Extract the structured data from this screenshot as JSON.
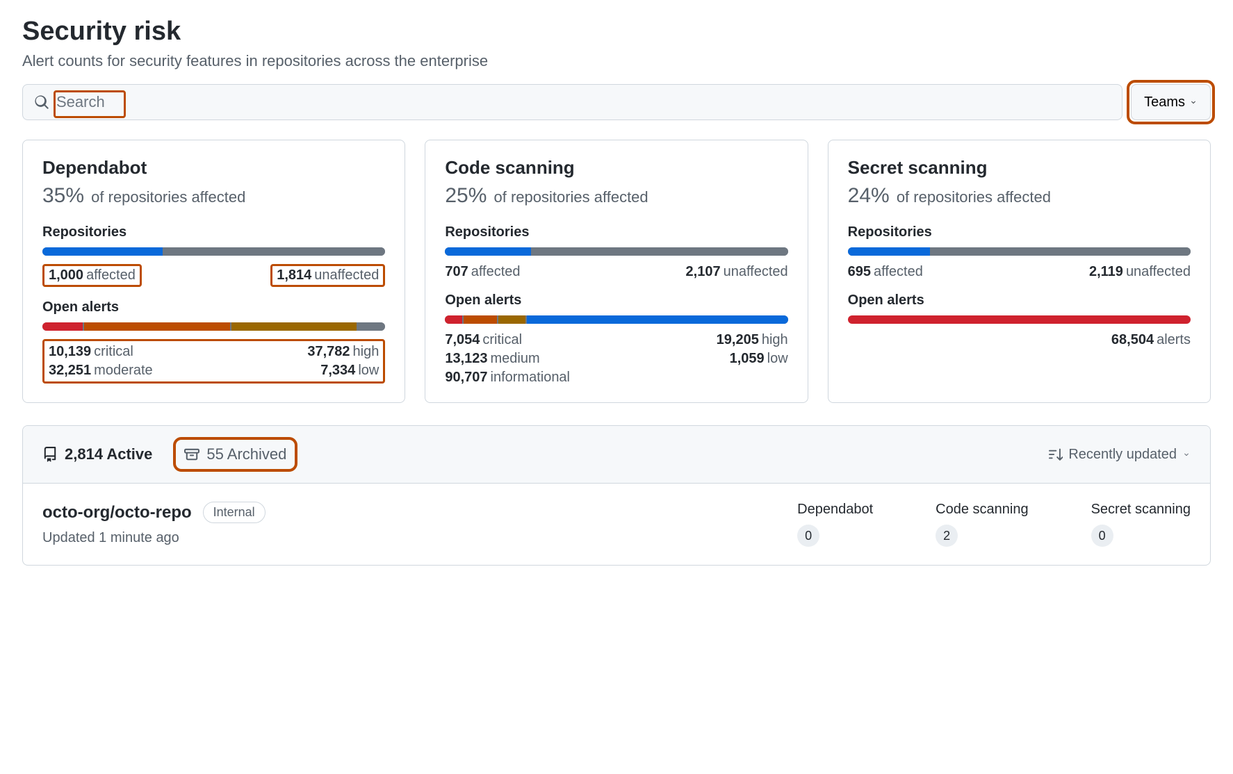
{
  "header": {
    "title": "Security risk",
    "subtitle": "Alert counts for security features in repositories across the enterprise"
  },
  "search": {
    "placeholder": "Search",
    "teams_button": "Teams"
  },
  "cards": [
    {
      "title": "Dependabot",
      "percent": "35%",
      "percent_suffix": "of repositories affected",
      "repos_label": "Repositories",
      "affected_count": "1,000",
      "affected_label": "affected",
      "unaffected_count": "1,814",
      "unaffected_label": "unaffected",
      "affected_pct": 35,
      "open_alerts_label": "Open alerts",
      "alerts": [
        {
          "count": "10,139",
          "label": "critical",
          "color": "crit",
          "pct": 12
        },
        {
          "count": "37,782",
          "label": "high",
          "color": "high",
          "pct": 43
        },
        {
          "count": "32,251",
          "label": "moderate",
          "color": "mod",
          "pct": 37
        },
        {
          "count": "7,334",
          "label": "low",
          "color": "low",
          "pct": 8
        }
      ],
      "highlight_repo_stats": true,
      "highlight_alert_stats": true
    },
    {
      "title": "Code scanning",
      "percent": "25%",
      "percent_suffix": "of repositories affected",
      "repos_label": "Repositories",
      "affected_count": "707",
      "affected_label": "affected",
      "unaffected_count": "2,107",
      "unaffected_label": "unaffected",
      "affected_pct": 25,
      "open_alerts_label": "Open alerts",
      "alerts": [
        {
          "count": "7,054",
          "label": "critical",
          "color": "crit",
          "pct": 5
        },
        {
          "count": "19,205",
          "label": "high",
          "color": "high",
          "pct": 10
        },
        {
          "count": "13,123",
          "label": "medium",
          "color": "med",
          "pct": 8
        },
        {
          "count": "1,059",
          "label": "low",
          "color": "low",
          "pct": 0
        },
        {
          "count": "90,707",
          "label": "informational",
          "color": "info",
          "pct": 77
        }
      ],
      "highlight_repo_stats": false,
      "highlight_alert_stats": false
    },
    {
      "title": "Secret scanning",
      "percent": "24%",
      "percent_suffix": "of repositories affected",
      "repos_label": "Repositories",
      "affected_count": "695",
      "affected_label": "affected",
      "unaffected_count": "2,119",
      "unaffected_label": "unaffected",
      "affected_pct": 24,
      "open_alerts_label": "Open alerts",
      "single_alert_count": "68,504",
      "single_alert_label": "alerts",
      "alerts_bar_single": 100,
      "highlight_repo_stats": false,
      "highlight_alert_stats": false
    }
  ],
  "repo_panel": {
    "active_count": "2,814",
    "active_label": "Active",
    "archived_count": "55",
    "archived_label": "Archived",
    "sort_label": "Recently updated",
    "highlight_archived": true
  },
  "repo_row": {
    "name": "octo-org/octo-repo",
    "visibility": "Internal",
    "updated": "Updated 1 minute ago",
    "metrics": [
      {
        "label": "Dependabot",
        "value": "0"
      },
      {
        "label": "Code scanning",
        "value": "2"
      },
      {
        "label": "Secret scanning",
        "value": "0"
      }
    ]
  }
}
